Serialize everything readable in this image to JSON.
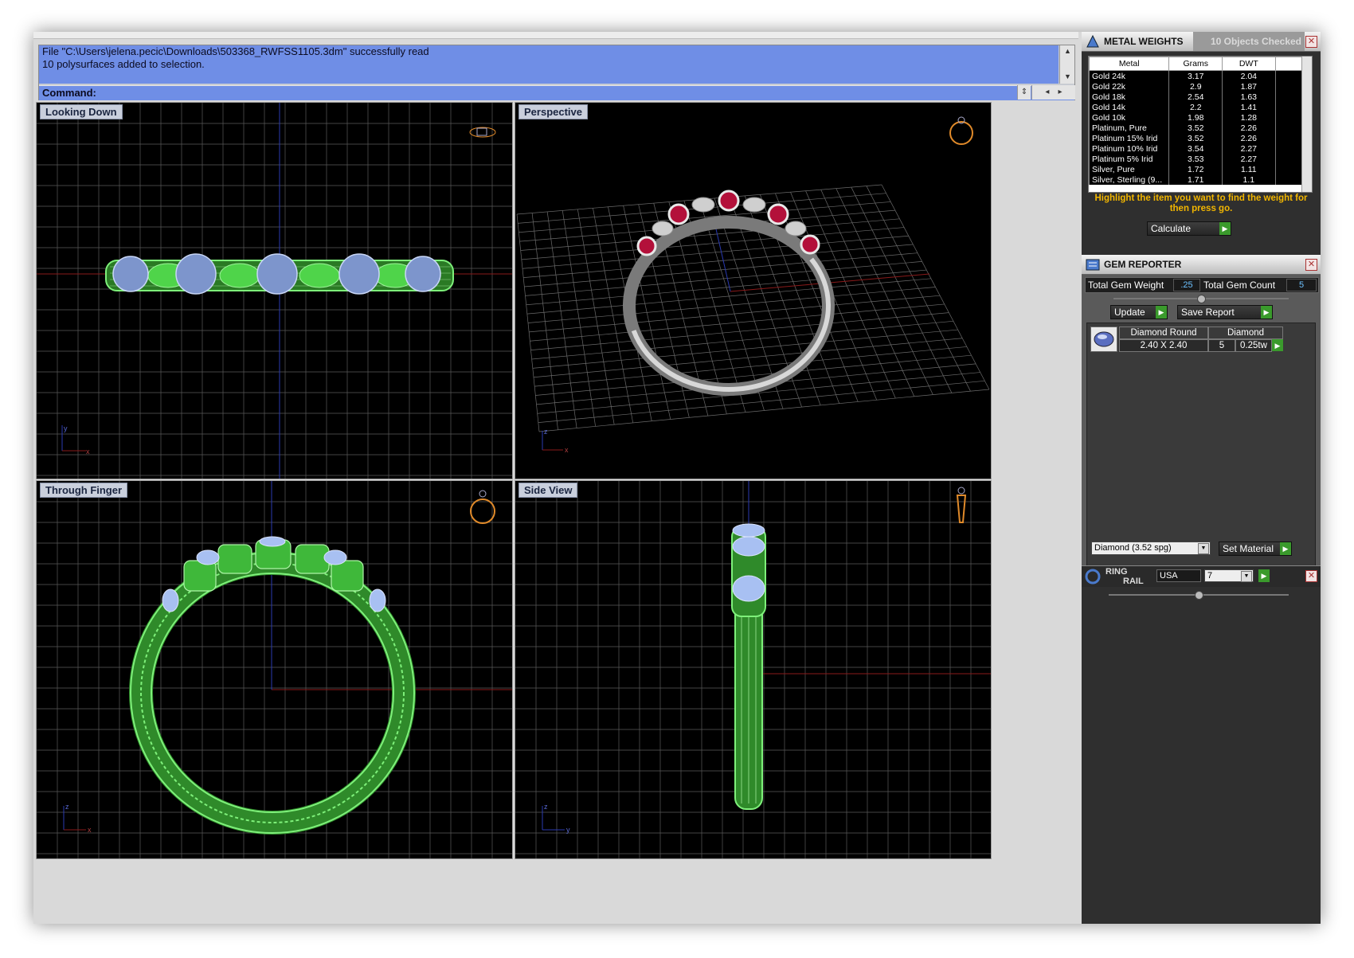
{
  "command_area": {
    "messages": [
      "File \"C:\\Users\\jelena.pecic\\Downloads\\503368_RWFSS1105.3dm\" successfully read",
      "10 polysurfaces added to selection."
    ],
    "command_label": "Command:",
    "command_value": ""
  },
  "viewports": {
    "top_left": "Looking Down",
    "top_right": "Perspective",
    "bottom_left": "Through Finger",
    "bottom_right": "Side View"
  },
  "axis_labels": {
    "x": "x",
    "y": "y",
    "z": "z"
  },
  "metal_weights": {
    "title": "METAL WEIGHTS",
    "objects_checked": "10 Objects Checked",
    "columns": [
      "Metal",
      "Grams",
      "DWT"
    ],
    "rows": [
      {
        "metal": "Gold 24k",
        "grams": "3.17",
        "dwt": "2.04"
      },
      {
        "metal": "Gold 22k",
        "grams": "2.9",
        "dwt": "1.87"
      },
      {
        "metal": "Gold 18k",
        "grams": "2.54",
        "dwt": "1.63"
      },
      {
        "metal": "Gold 14k",
        "grams": "2.2",
        "dwt": "1.41"
      },
      {
        "metal": "Gold 10k",
        "grams": "1.98",
        "dwt": "1.28"
      },
      {
        "metal": "Platinum, Pure",
        "grams": "3.52",
        "dwt": "2.26"
      },
      {
        "metal": "Platinum 15% Irid",
        "grams": "3.52",
        "dwt": "2.26"
      },
      {
        "metal": "Platinum 10% Irid",
        "grams": "3.54",
        "dwt": "2.27"
      },
      {
        "metal": "Platinum 5% Irid",
        "grams": "3.53",
        "dwt": "2.27"
      },
      {
        "metal": "Silver, Pure",
        "grams": "1.72",
        "dwt": "1.11"
      },
      {
        "metal": "Silver, Sterling (9...",
        "grams": "1.71",
        "dwt": "1.1"
      }
    ],
    "instruction": "Highlight the item you want to find the weight for then press go.",
    "calculate_label": "Calculate"
  },
  "gem_reporter": {
    "title": "GEM REPORTER",
    "total_weight_label": "Total Gem Weight",
    "total_weight_value": ".25",
    "total_count_label": "Total Gem Count",
    "total_count_value": "5",
    "update_label": "Update",
    "save_report_label": "Save Report",
    "gem": {
      "shape": "Diamond Round",
      "material": "Diamond",
      "size": "2.40 X 2.40",
      "count": "5",
      "weight": "0.25tw"
    },
    "material_select": "Diamond    (3.52 spg)",
    "set_material_label": "Set Material"
  },
  "ring_rail": {
    "title_line1": "RING",
    "title_line2": "RAIL",
    "country": "USA",
    "size": "7"
  },
  "colors": {
    "viewport_bg": "#000000",
    "grid": "#5a5a5a",
    "wireframe": "#7ef07a",
    "gem_wire": "#a8c0f2",
    "ruby": "#b3103a",
    "panel_bg": "#2f2f2f",
    "note": "#f2b600",
    "go": "#3a9a2c"
  },
  "icons": [
    "metal-weights-icon",
    "gem-reporter-icon",
    "ring-rail-icon",
    "ring-orientation-icon",
    "close-icon",
    "go-arrow-icon",
    "scroll-up-icon",
    "scroll-down-icon"
  ]
}
